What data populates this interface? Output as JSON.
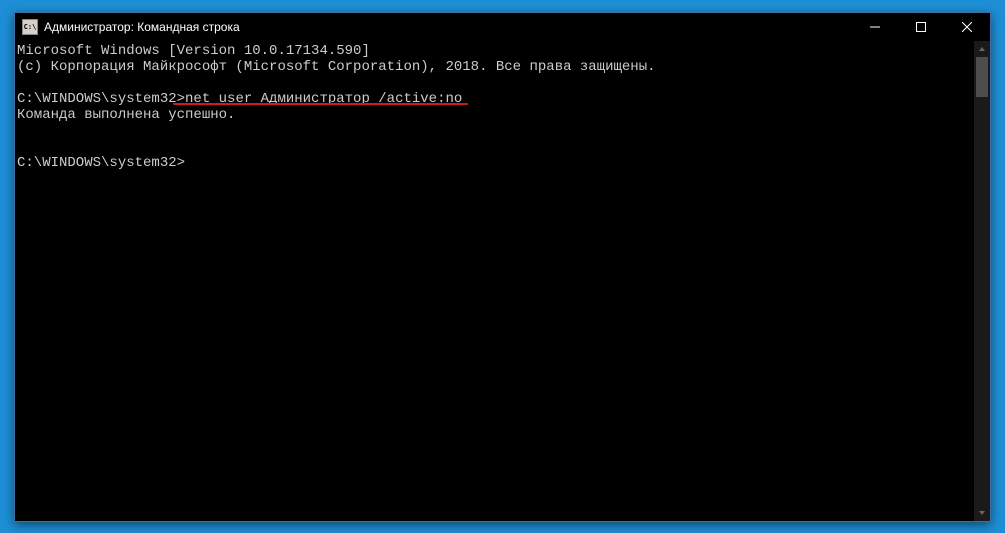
{
  "titlebar": {
    "icon_label": "C:\\",
    "title": "Администратор: Командная строка"
  },
  "console": {
    "line1": "Microsoft Windows [Version 10.0.17134.590]",
    "line2": "(c) Корпорация Майкрософт (Microsoft Corporation), 2018. Все права защищены.",
    "blank1": "",
    "prompt1": "C:\\WINDOWS\\system32>",
    "command1": "net user Администратор /active:no",
    "response1": "Команда выполнена успешно.",
    "blank2": "",
    "blank3": "",
    "prompt2": "C:\\WINDOWS\\system32>"
  }
}
